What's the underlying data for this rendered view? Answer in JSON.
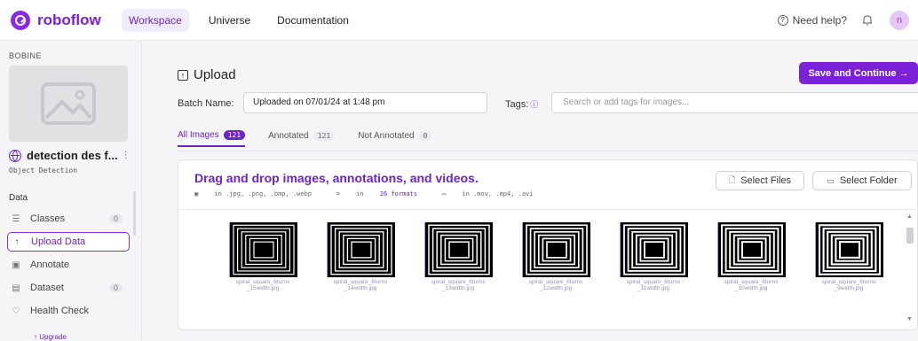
{
  "nav": {
    "brand": "roboflow",
    "tabs": [
      {
        "label": "Workspace"
      },
      {
        "label": "Universe"
      },
      {
        "label": "Documentation"
      }
    ],
    "help": "Need help?",
    "avatar": "n"
  },
  "sidebar": {
    "workspace": "BOBINE",
    "project_name": "detection des f...",
    "project_type": "Object Detection",
    "section": "Data",
    "items": [
      {
        "label": "Classes",
        "count": "0",
        "icon": "list-icon"
      },
      {
        "label": "Upload Data",
        "icon": "upload-arrow-icon"
      },
      {
        "label": "Annotate",
        "icon": "annotate-icon"
      },
      {
        "label": "Dataset",
        "count": "0",
        "icon": "dataset-icon"
      },
      {
        "label": "Health Check",
        "icon": "health-check-icon"
      }
    ],
    "upgrade": "↑ Upgrade"
  },
  "main": {
    "title": "Upload",
    "save_button": "Save and Continue →",
    "batch_label": "Batch Name:",
    "batch_value": "Uploaded on 07/01/24 at 1:48 pm",
    "tags_label": "Tags:",
    "tags_placeholder": "Search or add tags for images...",
    "tabs": [
      {
        "label": "All Images",
        "count": "121"
      },
      {
        "label": "Annotated",
        "count": "121"
      },
      {
        "label": "Not Annotated",
        "count": "0"
      }
    ]
  },
  "dropzone": {
    "title": "Drag and drop images, annotations, and videos.",
    "image_formats": "in .jpg, .png, .bmp, .webp",
    "annotation_formats_prefix": "in",
    "annotation_formats_link": "26 formats",
    "video_formats": "in .mov, .mp4, .avi",
    "select_files": "Select Files",
    "select_folder": "Select Folder"
  },
  "images": [
    {
      "name": "spiral_square_6turns_15width.jpg",
      "line1": "spiral_square_6turns",
      "line2": "_15width.jpg"
    },
    {
      "name": "spiral_square_6turns_14width.jpg",
      "line1": "spiral_square_6turns",
      "line2": "_14width.jpg"
    },
    {
      "name": "spiral_square_6turns_13width.jpg",
      "line1": "spiral_square_6turns",
      "line2": "_13width.jpg"
    },
    {
      "name": "spiral_square_6turns_12width.jpg",
      "line1": "spiral_square_6turns",
      "line2": "_12width.jpg"
    },
    {
      "name": "spiral_square_6turns_11width.jpg",
      "line1": "spiral_square_6turns",
      "line2": "_11width.jpg"
    },
    {
      "name": "spiral_square_6turns_10width.jpg",
      "line1": "spiral_square_6turns",
      "line2": "_10width.jpg"
    },
    {
      "name": "spiral_square_6turns_9width.jpg",
      "line1": "spiral_square_6turns",
      "line2": "_9width.jpg"
    }
  ],
  "colors": {
    "accent": "#7b22d9",
    "brand": "#7b1fd6"
  }
}
